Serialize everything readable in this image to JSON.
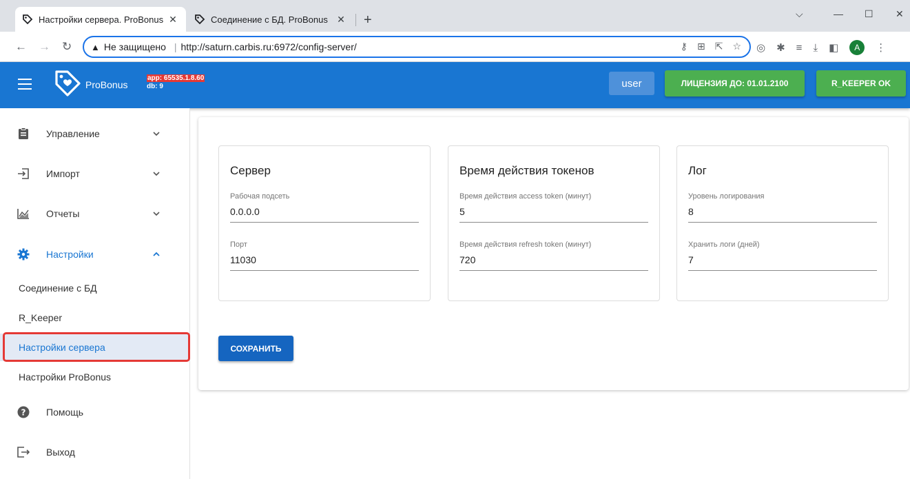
{
  "browser": {
    "tabs": [
      {
        "title": "Настройки сервера. ProBonus",
        "active": true
      },
      {
        "title": "Соединение с БД. ProBonus",
        "active": false
      }
    ],
    "new_tab": "+",
    "address": {
      "security_label": "Не защищено",
      "url": "http://saturn.carbis.ru:6972/config-server/"
    },
    "profile_initial": "A"
  },
  "header": {
    "brand": "ProBonus",
    "version_app": "app: 65535.1.8.60",
    "version_db": "db: 9",
    "user_label": "user",
    "license_label": "ЛИЦЕНЗИЯ ДО: 01.01.2100",
    "rkeeper_label": "R_KEEPER OK",
    "colors": {
      "bar": "#1976d2",
      "ok": "#4caf50",
      "badge": "#e53935"
    }
  },
  "sidebar": {
    "items": [
      {
        "label": "Управление",
        "icon": "clipboard-icon"
      },
      {
        "label": "Импорт",
        "icon": "import-icon"
      },
      {
        "label": "Отчеты",
        "icon": "chart-icon"
      },
      {
        "label": "Настройки",
        "icon": "gear-icon"
      }
    ],
    "subitems": [
      {
        "label": "Соединение с БД"
      },
      {
        "label": "R_Keeper"
      },
      {
        "label": "Настройки сервера"
      },
      {
        "label": "Настройки ProBonus"
      }
    ],
    "bottom": [
      {
        "label": "Помощь",
        "icon": "help-icon"
      },
      {
        "label": "Выход",
        "icon": "logout-icon"
      }
    ]
  },
  "cards": [
    {
      "title": "Сервер",
      "fields": [
        {
          "label": "Рабочая подсеть",
          "value": "0.0.0.0"
        },
        {
          "label": "Порт",
          "value": "11030"
        }
      ]
    },
    {
      "title": "Время действия токенов",
      "fields": [
        {
          "label": "Время действия access token (минут)",
          "value": "5"
        },
        {
          "label": "Время действия refresh token (минут)",
          "value": "720"
        }
      ]
    },
    {
      "title": "Лог",
      "fields": [
        {
          "label": "Уровень логирования",
          "value": "8"
        },
        {
          "label": "Хранить логи (дней)",
          "value": "7"
        }
      ]
    }
  ],
  "save_label": "СОХРАНИТЬ"
}
